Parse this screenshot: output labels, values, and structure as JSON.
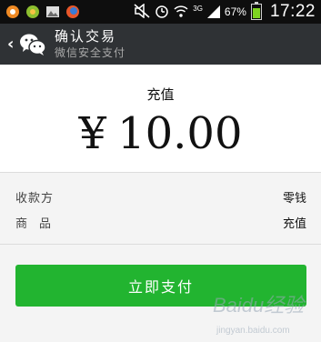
{
  "status_bar": {
    "network": "3G",
    "battery": "67%",
    "battery_fill": 0.67,
    "time": "17:22",
    "icons": [
      "app-icon-orange",
      "app-icon-green",
      "image-icon",
      "app-icon-firefox",
      "silent-icon",
      "alarm-icon",
      "wifi-icon",
      "signal-icon",
      "battery-icon"
    ]
  },
  "header": {
    "title": "确认交易",
    "subtitle": "微信安全支付",
    "icons": [
      "back-icon",
      "wechat-icon"
    ]
  },
  "amount": {
    "label": "充值",
    "currency": "¥",
    "value": "10.00"
  },
  "details": {
    "rows": [
      {
        "key": "收款方",
        "value": "零钱"
      },
      {
        "key": "商品",
        "value": "充值"
      }
    ]
  },
  "pay_button": {
    "label": "立即支付"
  },
  "watermark": {
    "text": "Baidu经验",
    "url": "jingyan.baidu.com"
  },
  "colors": {
    "header_bg": "#2f3235",
    "pay_button": "#22b430",
    "statusbar_bg": "#0e0e0e"
  }
}
